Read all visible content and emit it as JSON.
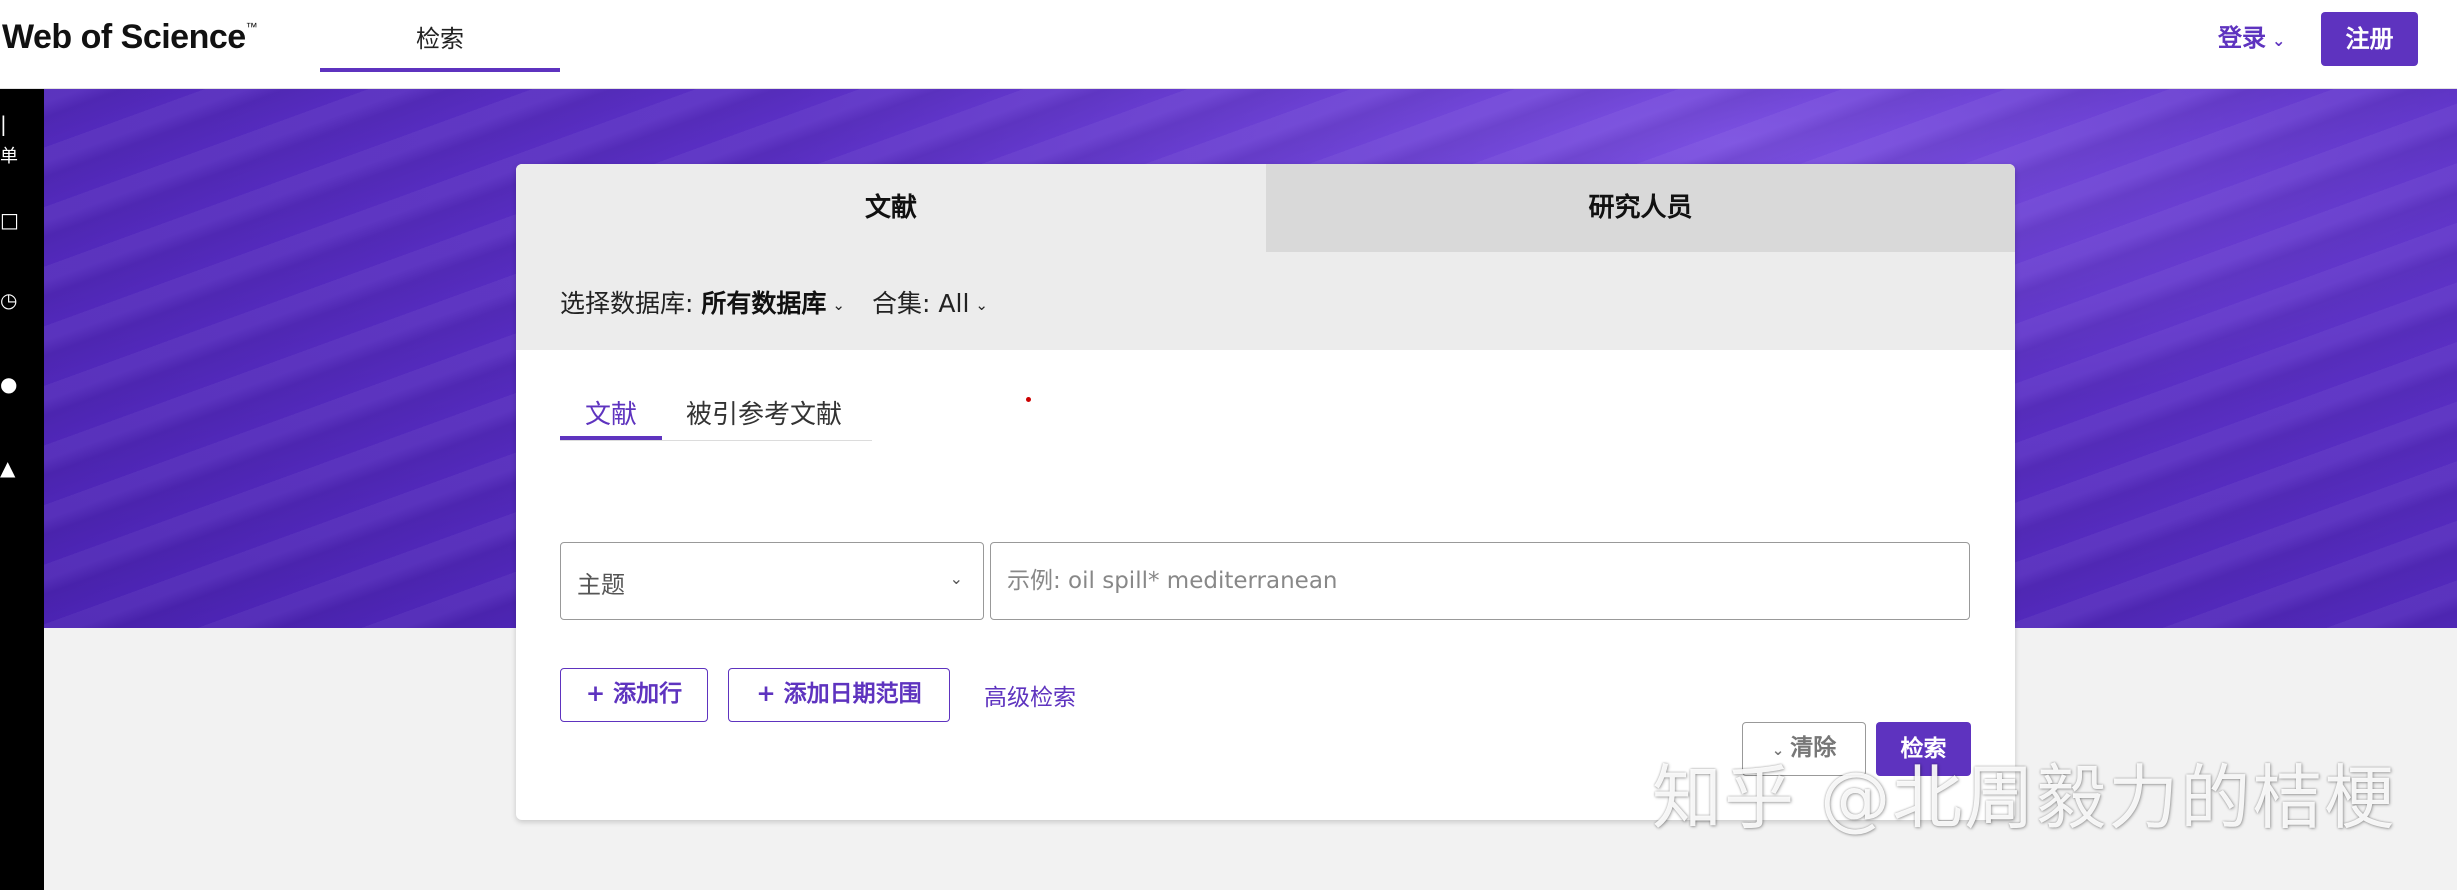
{
  "header": {
    "logo": "Web of Science",
    "logo_tm": "™",
    "nav_search": "检索",
    "login": "登录",
    "register": "注册"
  },
  "rail": {
    "items": [
      "|",
      "单",
      "□",
      "◷",
      "●",
      "▲"
    ]
  },
  "card": {
    "top_tabs": {
      "documents": "文献",
      "researchers": "研究人员"
    },
    "database": {
      "label": "选择数据库:",
      "value": "所有数据库"
    },
    "collection": {
      "label": "合集:",
      "value": "All"
    },
    "sub_tabs": {
      "documents": "文献",
      "cited_references": "被引参考文献"
    },
    "field": {
      "selected": "主题",
      "placeholder": "示例: oil spill* mediterranean",
      "value": ""
    },
    "buttons": {
      "add_row": "+ 添加行",
      "add_date_range": "+ 添加日期范围",
      "advanced_search": "高级检索",
      "clear": "清除",
      "search": "检索"
    }
  },
  "watermark": "知乎 @北周毅力的桔梗",
  "colors": {
    "accent": "#5e33bf",
    "hero": "#5a2fc4"
  }
}
